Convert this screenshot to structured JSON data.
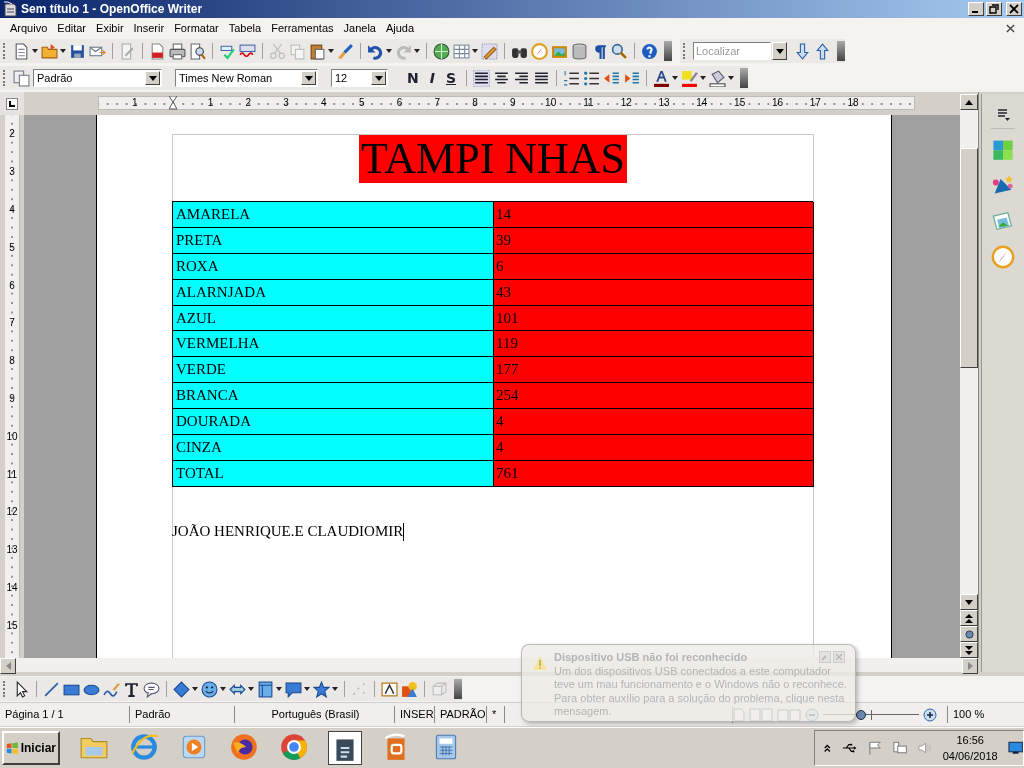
{
  "window": {
    "title": "Sem título 1 - OpenOffice Writer"
  },
  "menu": [
    "Arquivo",
    "Editar",
    "Exibir",
    "Inserir",
    "Formatar",
    "Tabela",
    "Ferramentas",
    "Janela",
    "Ajuda"
  ],
  "find_field": {
    "placeholder": "Localizar"
  },
  "format_bar": {
    "style": "Padrão",
    "font": "Times New Roman",
    "size": "12",
    "bold": "N",
    "italic": "I",
    "underline": "S"
  },
  "ruler": {
    "horizontal": [
      "1",
      "1",
      "2",
      "3",
      "4",
      "5",
      "6",
      "7",
      "8",
      "9",
      "10",
      "11",
      "12",
      "13",
      "14",
      "15",
      "16",
      "17",
      "18"
    ],
    "vertical": [
      "2",
      "3",
      "4",
      "5",
      "6",
      "7",
      "8",
      "9",
      "10",
      "11",
      "12",
      "13",
      "14",
      "15"
    ]
  },
  "document": {
    "title": "TAMPI NHAS",
    "table": [
      {
        "name": "AMARELA",
        "value": "14"
      },
      {
        "name": "PRETA",
        "value": "39"
      },
      {
        "name": "ROXA",
        "value": "6"
      },
      {
        "name": "ALARNJADA",
        "value": "43"
      },
      {
        "name": "AZUL",
        "value": "101"
      },
      {
        "name": "VERMELHA",
        "value": "119"
      },
      {
        "name": "VERDE",
        "value": "177"
      },
      {
        "name": "BRANCA",
        "value": "254"
      },
      {
        "name": "DOURADA",
        "value": "4"
      },
      {
        "name": "CINZA",
        "value": "4"
      },
      {
        "name": "TOTAL",
        "value": "761"
      }
    ],
    "text": "JOÃO HENRIQUE.E CLAUDIOMIR"
  },
  "status_bar": {
    "page": "Página 1 / 1",
    "page_style": "Padrão",
    "language": "Português (Brasil)",
    "insert_mode": "INSER",
    "selection_mode": "PADRÃO",
    "modified": "*",
    "zoom": {
      "level": 0.4,
      "label": "100 %"
    }
  },
  "notification": {
    "title": "Dispositivo USB não foi reconhecido",
    "message": "Um dos dispositivos USB conectados a este computador teve um mau funcionamento e o Windows não o reconhece. Para obter auxílio para a solução do problema, clique nesta mensagem."
  },
  "taskbar": {
    "start": "Iniciar",
    "time": "16:56",
    "date": "04/06/2018"
  }
}
